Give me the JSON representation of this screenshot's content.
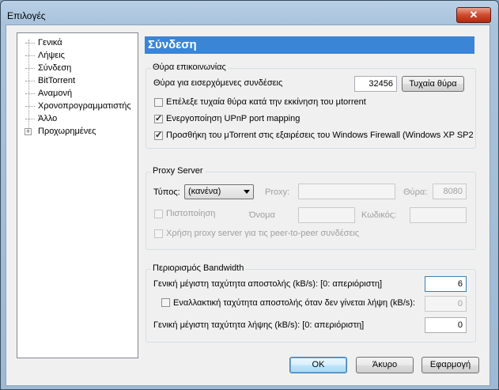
{
  "window": {
    "title": "Επιλογές",
    "close_glyph": "✕"
  },
  "tree": {
    "items": [
      {
        "label": "Γενικά"
      },
      {
        "label": "Λήψεις"
      },
      {
        "label": "Σύνδεση"
      },
      {
        "label": "BitTorrent"
      },
      {
        "label": "Αναμονή"
      },
      {
        "label": "Χρονοπρογραμματιστής"
      },
      {
        "label": "Άλλο"
      },
      {
        "label": "Προχωρημένες"
      }
    ],
    "expander_glyph": "+"
  },
  "page": {
    "header": "Σύνδεση"
  },
  "port": {
    "group_title": "Θύρα επικοινωνίας",
    "incoming_label": "Θύρα για εισερχόμενες συνδέσεις",
    "port_value": "32456",
    "random_button": "Τυχαία θύρα",
    "checks": [
      {
        "label": "Επέλεξε τυχαία θύρα κατά την εκκίνηση του μtorrent",
        "checked": false
      },
      {
        "label": "Ενεργοποίηση UPnP port mapping",
        "checked": true
      },
      {
        "label": "Προσθήκη του μTorrent στις εξαιρέσεις του Windows Firewall (Windows XP SP2",
        "checked": true
      }
    ]
  },
  "proxy": {
    "group_title": "Proxy Server",
    "type_label": "Τύπος:",
    "type_value": "(κανένα)",
    "proxy_label": "Proxy:",
    "port_label": "Θύρα:",
    "port_value": "8080",
    "auth_label": "Πιστοποίηση",
    "name_label": "Όνομα",
    "password_label": "Κωδικός:",
    "p2p_label": "Χρήση proxy server για τις peer-to-peer συνδέσεις"
  },
  "bandwidth": {
    "group_title": "Περιορισμός Bandwidth",
    "upload_label": "Γενική μέγιστη ταχύτητα αποστολής (kB/s): [0: απεριόριστη]",
    "upload_value": "6",
    "alt_upload_label": "Εναλλακτική ταχύτητα αποστολής όταν δεν γίνεται λήψη (kB/s):",
    "alt_upload_value": "0",
    "download_label": "Γενική μέγιστη ταχύτητα λήψης (kB/s): [0: απεριόριστη]",
    "download_value": "0"
  },
  "buttons": {
    "ok": "OK",
    "cancel": "Άκυρο",
    "apply": "Εφαρμογή"
  }
}
